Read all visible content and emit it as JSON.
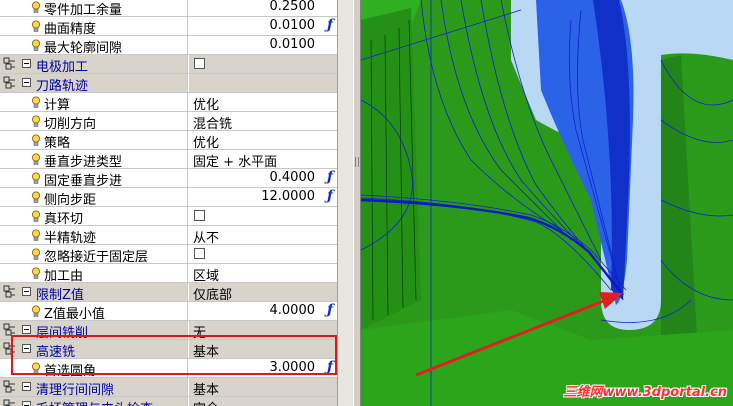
{
  "properties": [
    {
      "type": "prop",
      "name": "零件加工余量",
      "value": "0.2500",
      "value_align": "num",
      "f": false
    },
    {
      "type": "prop",
      "name": "曲面精度",
      "value": "0.0100",
      "value_align": "num",
      "f": true
    },
    {
      "type": "prop",
      "name": "最大轮廓间隙",
      "value": "0.0100",
      "value_align": "num",
      "f": false
    },
    {
      "type": "cat",
      "name": "电极加工",
      "checkbox": true
    },
    {
      "type": "cat",
      "name": "刀路轨迹",
      "value": ""
    },
    {
      "type": "prop",
      "name": "计算",
      "value": "优化",
      "value_align": "text"
    },
    {
      "type": "prop",
      "name": "切削方向",
      "value": "混合铣",
      "value_align": "text"
    },
    {
      "type": "prop",
      "name": "策略",
      "value": "优化",
      "value_align": "text"
    },
    {
      "type": "prop",
      "name": "垂直步进类型",
      "value": "固定 + 水平面",
      "value_align": "text"
    },
    {
      "type": "prop",
      "name": "固定垂直步进",
      "value": "0.4000",
      "value_align": "num",
      "f": true
    },
    {
      "type": "prop",
      "name": "侧向步距",
      "value": "12.0000",
      "value_align": "num",
      "f": true
    },
    {
      "type": "prop",
      "name": "真环切",
      "checkbox": true
    },
    {
      "type": "prop",
      "name": "半精轨迹",
      "value": "从不",
      "value_align": "text"
    },
    {
      "type": "prop",
      "name": "忽略接近于固定层",
      "checkbox": true
    },
    {
      "type": "prop",
      "name": "加工由",
      "value": "区域",
      "value_align": "text"
    },
    {
      "type": "cat",
      "name": "限制Z值",
      "value": "仅底部"
    },
    {
      "type": "prop",
      "name": "Z值最小值",
      "value": "4.0000",
      "value_align": "num",
      "f": true
    },
    {
      "type": "cat",
      "name": "层间铣削",
      "value": "无"
    },
    {
      "type": "cat",
      "name": "高速铣",
      "value": "基本"
    },
    {
      "type": "prop",
      "name": "首选圆角",
      "value": "3.0000",
      "value_align": "num",
      "f": true
    },
    {
      "type": "cat",
      "name": "清理行间间隙",
      "value": "基本"
    },
    {
      "type": "cat",
      "name": "毛坯管理与夹头检查",
      "value": "完全"
    }
  ],
  "watermark": "三维网www.3dportal.cn",
  "colors": {
    "highlight": "#e01818",
    "model_green": "#2b9a1a",
    "toolpath_blue": "#1020d0"
  }
}
